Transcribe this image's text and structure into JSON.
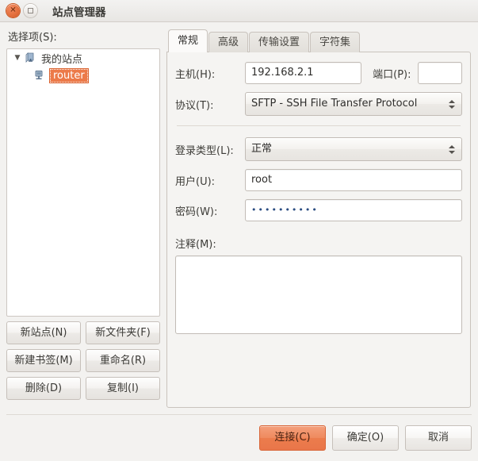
{
  "window": {
    "title": "站点管理器",
    "close_icon": "close-icon",
    "maximize_icon": "maximize-icon"
  },
  "left": {
    "section_label": "选择项(S):",
    "tree": [
      {
        "label": "我的站点",
        "icon": "server-group-icon",
        "twisty": "▼",
        "level": 1,
        "selected": false
      },
      {
        "label": "router",
        "icon": "server-icon",
        "twisty": "",
        "level": 2,
        "selected": true
      }
    ],
    "buttons": [
      {
        "label": "新站点(N)",
        "name": "new-site-button"
      },
      {
        "label": "新文件夹(F)",
        "name": "new-folder-button"
      },
      {
        "label": "新建书签(M)",
        "name": "new-bookmark-button"
      },
      {
        "label": "重命名(R)",
        "name": "rename-button"
      },
      {
        "label": "删除(D)",
        "name": "delete-button"
      },
      {
        "label": "复制(I)",
        "name": "duplicate-button"
      }
    ]
  },
  "tabs": [
    {
      "label": "常规",
      "active": true
    },
    {
      "label": "高级",
      "active": false
    },
    {
      "label": "传输设置",
      "active": false
    },
    {
      "label": "字符集",
      "active": false
    }
  ],
  "general": {
    "host_label": "主机(H):",
    "host_value": "192.168.2.1",
    "host_placeholder": "",
    "port_label": "端口(P):",
    "port_value": "",
    "port_placeholder": "",
    "protocol_label": "协议(T):",
    "protocol_value": "SFTP - SSH File Transfer Protocol",
    "logon_label": "登录类型(L):",
    "logon_value": "正常",
    "user_label": "用户(U):",
    "user_value": "root",
    "user_placeholder": "",
    "password_label": "密码(W):",
    "password_value": "••••••••••",
    "notes_label": "注释(M):",
    "notes_value": ""
  },
  "footer": {
    "connect_label": "连接(C)",
    "ok_label": "确定(O)",
    "cancel_label": "取消"
  },
  "colors": {
    "accent": "#ec7a49",
    "window_bg": "#f3f2f0",
    "field_bg": "#ffffff",
    "selection": "#ec7a49"
  }
}
